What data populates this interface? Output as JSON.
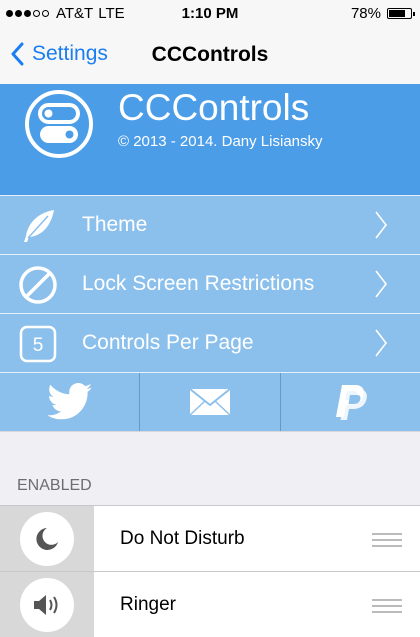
{
  "status": {
    "carrier": "AT&T",
    "network": "LTE",
    "time": "1:10 PM",
    "battery": "78%",
    "battery_level": 0.78,
    "signal_bars": 3,
    "signal_max": 5
  },
  "nav": {
    "back_label": "Settings",
    "title": "CCControls"
  },
  "header": {
    "app_title": "CCControls",
    "copyright": "© 2013 - 2014. Dany Lisiansky",
    "logo_icon": "toggle-switch-icon"
  },
  "menu": [
    {
      "label": "Theme",
      "icon": "feather-icon"
    },
    {
      "label": "Lock Screen Restrictions",
      "icon": "prohibited-icon"
    },
    {
      "label": "Controls Per Page",
      "icon": "number-badge-icon",
      "badge": "5"
    }
  ],
  "social": [
    {
      "icon": "twitter-icon"
    },
    {
      "icon": "mail-icon"
    },
    {
      "icon": "paypal-icon"
    }
  ],
  "section_header": "ENABLED",
  "enabled": [
    {
      "label": "Do Not Disturb",
      "icon": "moon-icon"
    },
    {
      "label": "Ringer",
      "icon": "speaker-icon"
    }
  ],
  "colors": {
    "accent": "#1a7ef2",
    "header_bg": "#4b9de8",
    "row_bg": "#8cc0ec"
  }
}
